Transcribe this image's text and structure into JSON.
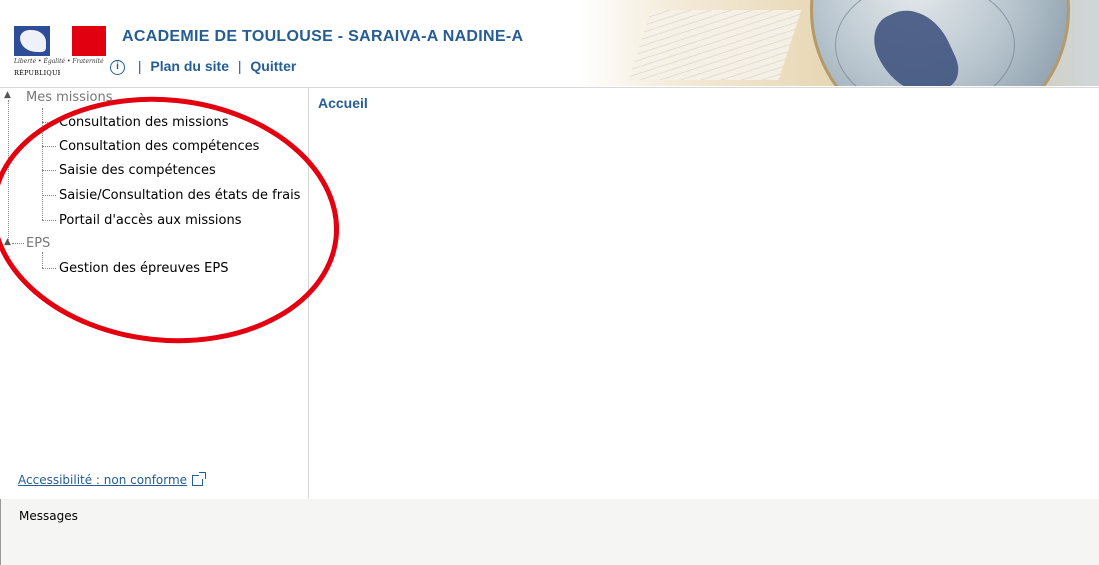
{
  "header": {
    "logo": {
      "motto": "Liberté • Égalité • Fraternité",
      "republic": "RÉPUBLIQUE FRANÇAISE"
    },
    "site_title": "ACADEMIE DE TOULOUSE - SARAIVA-A NADINE-A",
    "links": {
      "sitemap": "Plan du site",
      "quit": "Quitter",
      "separator": "|"
    }
  },
  "sidebar": {
    "tree": [
      {
        "label": "Mes missions",
        "children": [
          "Consultation des missions",
          "Consultation des compétences",
          "Saisie des compétences",
          "Saisie/Consultation des états de frais",
          "Portail d'accès aux missions"
        ]
      },
      {
        "label": "EPS",
        "children": [
          "Gestion des épreuves EPS"
        ]
      }
    ],
    "accessibility_link": "Accessibilité : non conforme"
  },
  "main": {
    "title": "Accueil"
  },
  "messages": {
    "title": "Messages"
  },
  "colors": {
    "accent": "#255d94",
    "annotation": "#e3000f",
    "messages_bg": "#f5f5f3"
  }
}
